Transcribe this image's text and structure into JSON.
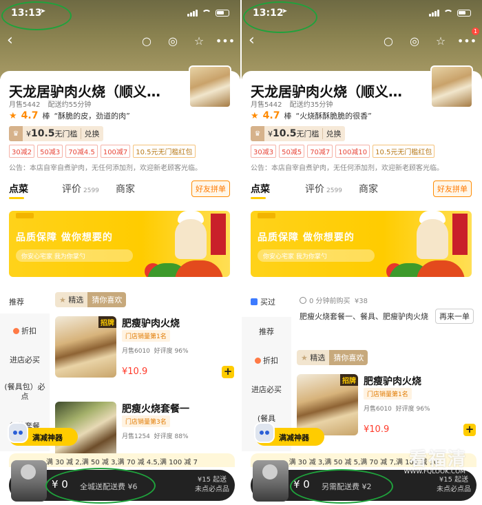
{
  "left": {
    "status_time": "13:13",
    "title": "天龙居驴肉火烧（顺义…",
    "monthly_sales": "月售5442",
    "delivery_time": "配送约55分钟",
    "score": "4.7",
    "score_word": "棒",
    "review_quote": "“酥脆的皮，劲道的肉”",
    "coupon_amount": "10.5",
    "coupon_unit": "¥",
    "coupon_label": "无门槛",
    "coupon_exchange": "兑换",
    "discount_tags": [
      "30减2",
      "50减3",
      "70减4.5",
      "100减7"
    ],
    "red_packet": "10.5元无门槛红包",
    "notice": "公告：本店自宰自煮驴肉，无任何添加剂，欢迎新老顾客光临。",
    "tabs": [
      {
        "label": "点菜"
      },
      {
        "label": "评价",
        "count": "2599"
      },
      {
        "label": "商家"
      }
    ],
    "group_buy": "好友拼单",
    "banner_title": "品质保障 做你想要的",
    "banner_sub": "你安心宅家 我为你掌勺",
    "side_items": [
      "推荐",
      "折扣",
      "进店必买",
      "(餐具包）必点",
      "超值套餐"
    ],
    "chips": [
      "精选",
      "猜你喜欢"
    ],
    "foods": [
      {
        "badge": "招牌",
        "name": "肥瘦驴肉火烧",
        "rank": "门店销量第1名",
        "sold": "月售6010",
        "praise": "好评度 96%",
        "price": "10.9"
      },
      {
        "name": "肥瘦火烧套餐一",
        "rank": "门店销量第3名",
        "sold": "月售1254",
        "praise": "好评度 88%"
      }
    ],
    "robot_label": "满减神器",
    "promo": "满 30 减 2,满 50 减 3,满 70 减 4.5,满 100 减 7",
    "cart_amount": "¥ 0",
    "fee_text": "全城送配送费 ¥6",
    "min_order": "¥15 起送",
    "min_note": "未点必点品"
  },
  "right": {
    "status_time": "13:12",
    "notif_count": "1",
    "title": "天龙居驴肉火烧（顺义…",
    "monthly_sales": "月售5442",
    "delivery_time": "配送约35分钟",
    "score": "4.7",
    "score_word": "棒",
    "review_quote": "“火烧酥酥脆脆的很香”",
    "coupon_amount": "10.5",
    "coupon_unit": "¥",
    "coupon_label": "无门槛",
    "coupon_exchange": "兑换",
    "discount_tags": [
      "30减3",
      "50减5",
      "70减7",
      "100减10"
    ],
    "red_packet": "10.5元无门槛红包",
    "notice": "公告：本店自宰自煮驴肉，无任何添加剂，欢迎新老顾客光临。",
    "tabs": [
      {
        "label": "点菜"
      },
      {
        "label": "评价",
        "count": "2599"
      },
      {
        "label": "商家"
      }
    ],
    "group_buy": "好友拼单",
    "banner_title": "品质保障 做你想要的",
    "banner_sub": "你安心宅家 我为你掌勺",
    "bought_label": "买过",
    "history_time": "0 分钟前购买",
    "history_price": "¥38",
    "history_desc": "肥瘦火烧套餐一、餐具、肥瘦驴肉火烧",
    "again": "再来一单",
    "side_items": [
      "推荐",
      "折扣",
      "进店必买",
      "(餐具"
    ],
    "chips": [
      "精选",
      "猜你喜欢"
    ],
    "food": {
      "badge": "招牌",
      "name": "肥瘦驴肉火烧",
      "rank": "门店销量第1名",
      "sold": "月售6010",
      "praise": "好评度 96%",
      "price": "10.9"
    },
    "robot_label": "满减神器",
    "promo": "满 30 减 3,满 50 减 5,满 70 减 7,满 100 减 10",
    "cart_amount": "¥ 0",
    "fee_text": "另需配送费 ¥2",
    "min_order": "¥15 起送",
    "min_note": "未点必点品"
  },
  "watermark": {
    "text": "看福清",
    "url": "WWW.FQLOOK.COM"
  },
  "colors": {
    "accent": "#ffcc00",
    "price": "#ff3a2a",
    "orange": "#ff8a00",
    "annotation_ring": "#1fa23c"
  }
}
